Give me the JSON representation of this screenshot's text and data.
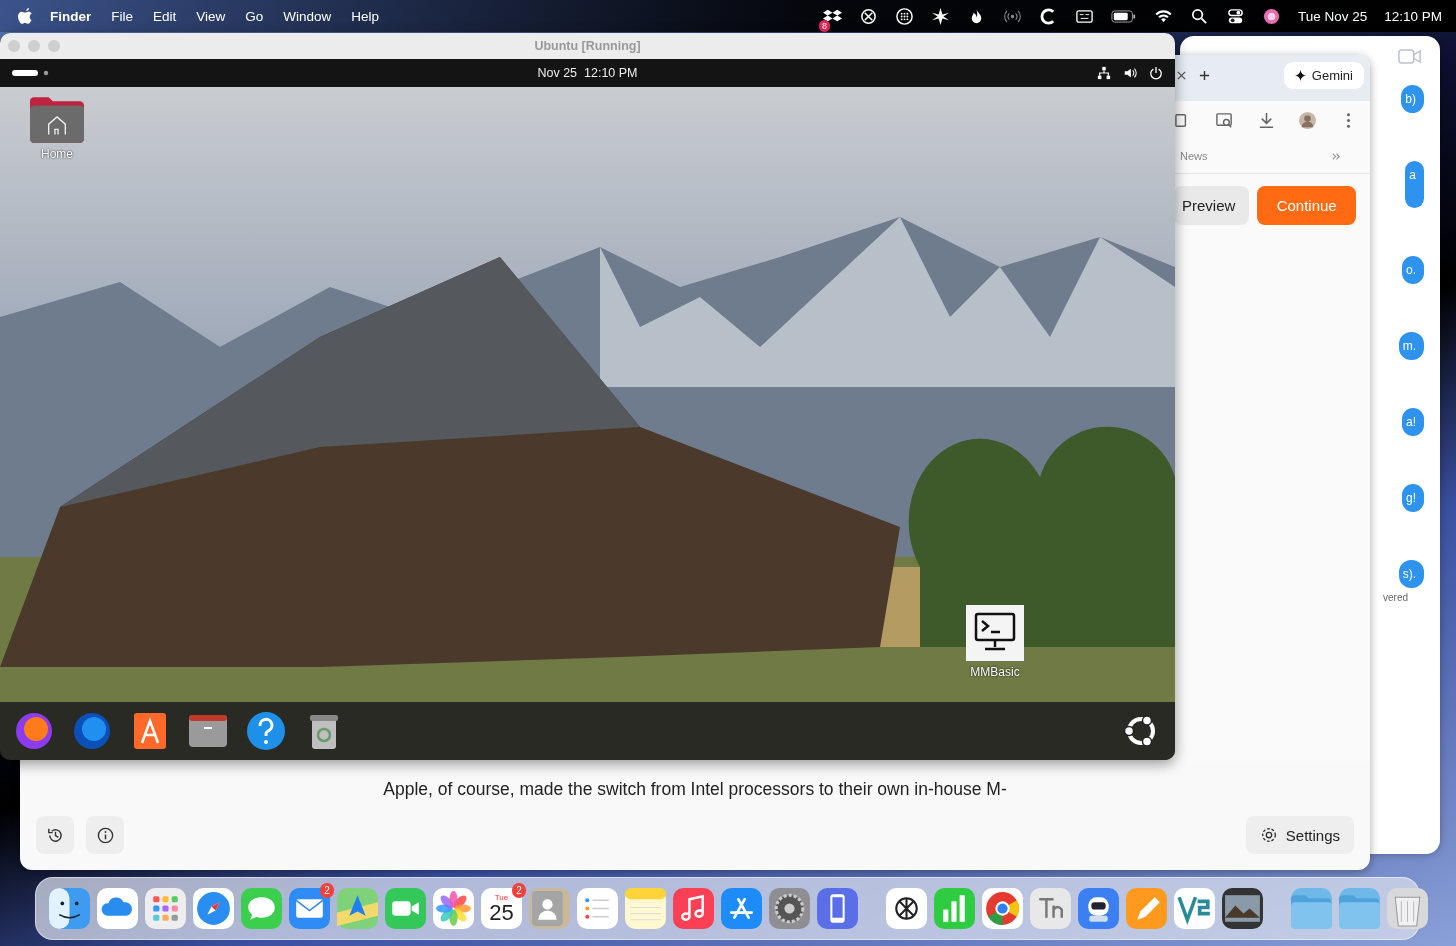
{
  "menu_bar": {
    "app_name": "Finder",
    "menus": [
      "File",
      "Edit",
      "View",
      "Go",
      "Window",
      "Help"
    ],
    "dropbox_badge": "8",
    "date": "Tue Nov 25",
    "time": "12:10 PM"
  },
  "messages_window": {
    "bubbles": [
      "b)",
      "a",
      "o.",
      "m.",
      "a!",
      "g!",
      "s)."
    ],
    "status": "vered"
  },
  "browser_window": {
    "gemini_label": "Gemini",
    "bookmarks": [
      "News"
    ],
    "actions": [
      {
        "label": "Preview",
        "kind": "secondary"
      },
      {
        "label": "Continue",
        "kind": "primary"
      }
    ],
    "body_text": "Apple, of course, made the switch from Intel processors to their own in-house M-",
    "settings_label": "Settings"
  },
  "vm_window": {
    "title": "Ubuntu [Running]",
    "clock": "Nov 25  12:10 PM",
    "desktop_icons": [
      {
        "label": "Home",
        "kind": "home-folder"
      },
      {
        "label": "MMBasic",
        "kind": "terminal"
      }
    ],
    "dock": [
      {
        "kind": "firefox"
      },
      {
        "kind": "thunderbird"
      },
      {
        "kind": "app-center"
      },
      {
        "kind": "files"
      },
      {
        "kind": "help"
      },
      {
        "kind": "trash"
      }
    ]
  },
  "dock": {
    "items": [
      {
        "kind": "finder"
      },
      {
        "kind": "icloud"
      },
      {
        "kind": "launchpad"
      },
      {
        "kind": "safari"
      },
      {
        "kind": "messages"
      },
      {
        "kind": "mail",
        "badge": "2"
      },
      {
        "kind": "maps"
      },
      {
        "kind": "facetime"
      },
      {
        "kind": "photos"
      },
      {
        "kind": "calendar",
        "day": "Tue",
        "date": "25",
        "badge": "2"
      },
      {
        "kind": "contacts"
      },
      {
        "kind": "reminders"
      },
      {
        "kind": "notes"
      },
      {
        "kind": "music"
      },
      {
        "kind": "app-store"
      },
      {
        "kind": "settings"
      },
      {
        "kind": "iphone"
      },
      {
        "kind": "separator"
      },
      {
        "kind": "chatgpt"
      },
      {
        "kind": "numbers"
      },
      {
        "kind": "chrome"
      },
      {
        "kind": "fonts"
      },
      {
        "kind": "robot"
      },
      {
        "kind": "pages"
      },
      {
        "kind": "vs"
      },
      {
        "kind": "preview"
      },
      {
        "kind": "separator"
      },
      {
        "kind": "apps-folder"
      },
      {
        "kind": "downloads-folder"
      },
      {
        "kind": "bin"
      }
    ]
  }
}
